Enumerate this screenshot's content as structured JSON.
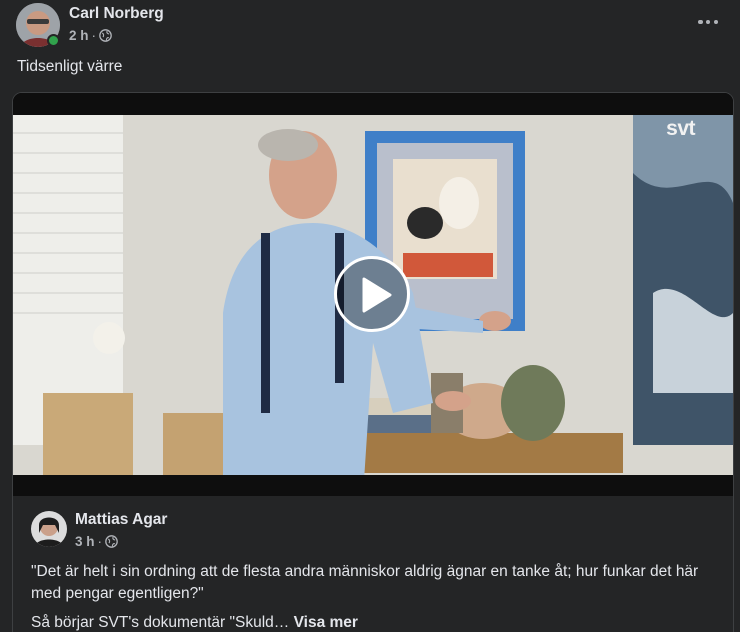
{
  "post": {
    "author": "Carl Norberg",
    "time": "2 h",
    "separator": "·",
    "visibility_icon": "globe-icon",
    "more_icon": "more-options-icon",
    "text": "Tidsenligt värre"
  },
  "shared": {
    "video": {
      "watermark": "svt",
      "play_icon": "play-icon"
    },
    "author": "Mattias Agar",
    "time": "3 h",
    "separator": "·",
    "visibility_icon": "globe-icon",
    "quote": "\"Det är helt i sin ordning att de flesta andra människor aldrig ägnar en tanke åt; hur funkar det här med pengar egentligen?\"",
    "teaser": "Så börjar SVT's dokumentär \"Skuld…",
    "see_more": "Visa mer"
  },
  "colors": {
    "background": "#242526",
    "text_primary": "#e4e6eb",
    "text_secondary": "#b0b3b8",
    "online": "#31a24c"
  }
}
